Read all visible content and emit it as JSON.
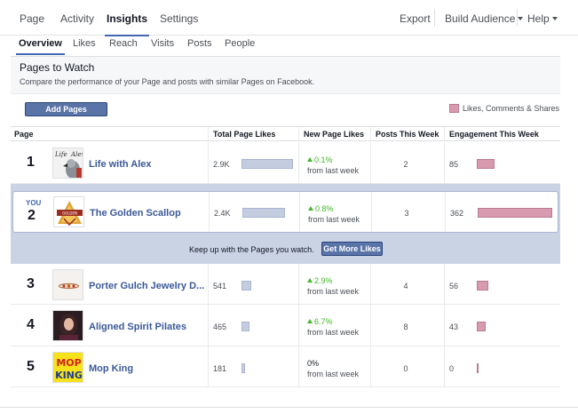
{
  "topnav": {
    "items": [
      "Page",
      "Activity",
      "Insights",
      "Settings"
    ],
    "right": {
      "export": "Export",
      "build_audience": "Build Audience",
      "help": "Help"
    }
  },
  "subnav": {
    "items": [
      "Overview",
      "Likes",
      "Reach",
      "Visits",
      "Posts",
      "People"
    ]
  },
  "section": {
    "title": "Pages to Watch",
    "subtitle": "Compare the performance of your Page and posts with similar Pages on Facebook."
  },
  "add_button": "Add Pages",
  "legend": "Likes, Comments & Shares",
  "headers": [
    "Page",
    "Total Page Likes",
    "New Page Likes",
    "Posts This Week",
    "Engagement This Week"
  ],
  "you_label": "YOU",
  "from_last_week": "from last week",
  "keep_up": {
    "text": "Keep up with the Pages you watch.",
    "button": "Get More Likes"
  },
  "colors": {
    "accent": "#4267b2",
    "link": "#3b5998",
    "growth": "#42b72a",
    "likes_bar": "#c4cde0",
    "engagement_bar": "#d89aae",
    "band": "#c9d3e4"
  },
  "rows": [
    {
      "rank": "1",
      "name": "Life with Alex",
      "total_likes": "2.9K",
      "total_likes_value": 2900,
      "new_likes": "0.1%",
      "trend": "up",
      "posts": "2",
      "engagement": "85",
      "engagement_value": 85,
      "thumb_icon": "parrot-thumbnail-icon"
    },
    {
      "rank": "2",
      "name": "The Golden Scallop",
      "total_likes": "2.4K",
      "total_likes_value": 2400,
      "new_likes": "0.8%",
      "trend": "up",
      "posts": "3",
      "engagement": "362",
      "engagement_value": 362,
      "thumb_icon": "scallop-logo-thumbnail-icon"
    },
    {
      "rank": "3",
      "name": "Porter Gulch Jewelry D...",
      "total_likes": "541",
      "total_likes_value": 541,
      "new_likes": "2.9%",
      "trend": "up",
      "posts": "4",
      "engagement": "56",
      "engagement_value": 56,
      "thumb_icon": "jewelry-thumbnail-icon"
    },
    {
      "rank": "4",
      "name": "Aligned Spirit Pilates",
      "total_likes": "465",
      "total_likes_value": 465,
      "new_likes": "6.7%",
      "trend": "up",
      "posts": "8",
      "engagement": "43",
      "engagement_value": 43,
      "thumb_icon": "portrait-thumbnail-icon"
    },
    {
      "rank": "5",
      "name": "Mop King",
      "total_likes": "181",
      "total_likes_value": 181,
      "new_likes": "0%",
      "trend": "flat",
      "posts": "0",
      "engagement": "0",
      "engagement_value": 0,
      "thumb_icon": "mop-king-logo-thumbnail-icon"
    }
  ]
}
